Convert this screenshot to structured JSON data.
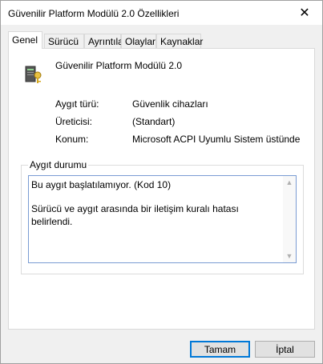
{
  "window": {
    "title": "Güvenilir Platform Modülü 2.0 Özellikleri",
    "close_glyph": "✕"
  },
  "tabs": [
    {
      "label": "Genel",
      "active": true
    },
    {
      "label": "Sürücü",
      "active": false
    },
    {
      "label": "Ayrıntılar",
      "active": false
    },
    {
      "label": "Olaylar",
      "active": false
    },
    {
      "label": "Kaynaklar",
      "active": false
    }
  ],
  "device": {
    "name": "Güvenilir Platform Modülü 2.0",
    "icon": "security-device-icon"
  },
  "properties": [
    {
      "label": "Aygıt türü:",
      "value": "Güvenlik cihazları"
    },
    {
      "label": "Üreticisi:",
      "value": "(Standart)"
    },
    {
      "label": "Konum:",
      "value": "Microsoft ACPI Uyumlu Sistem üstünde"
    }
  ],
  "status": {
    "group_title": "Aygıt durumu",
    "line1": "Bu aygıt başlatılamıyor. (Kod 10)",
    "line2": "Sürücü ve aygıt arasında bir iletişim kuralı hatası belirlendi."
  },
  "buttons": {
    "ok": "Tamam",
    "cancel": "İptal"
  }
}
